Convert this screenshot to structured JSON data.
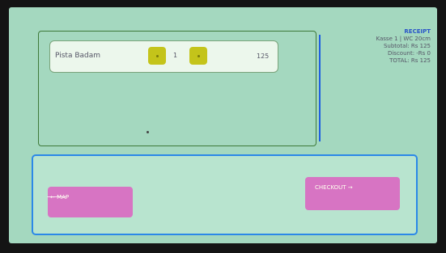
{
  "cart": {
    "items": [
      {
        "name": "Pista Badam",
        "quantity": "1",
        "price": "125"
      }
    ]
  },
  "receipt": {
    "title": "RECEIPT",
    "header": "Kasse 1 | WC 20cm",
    "subtotal": "Subtotal: Rs 125",
    "discount": "Discount: -Rs 0",
    "total": "TOTAL: Rs 125"
  },
  "actions": {
    "map_label": "← MAP",
    "checkout_label": "CHECKOUT →"
  }
}
